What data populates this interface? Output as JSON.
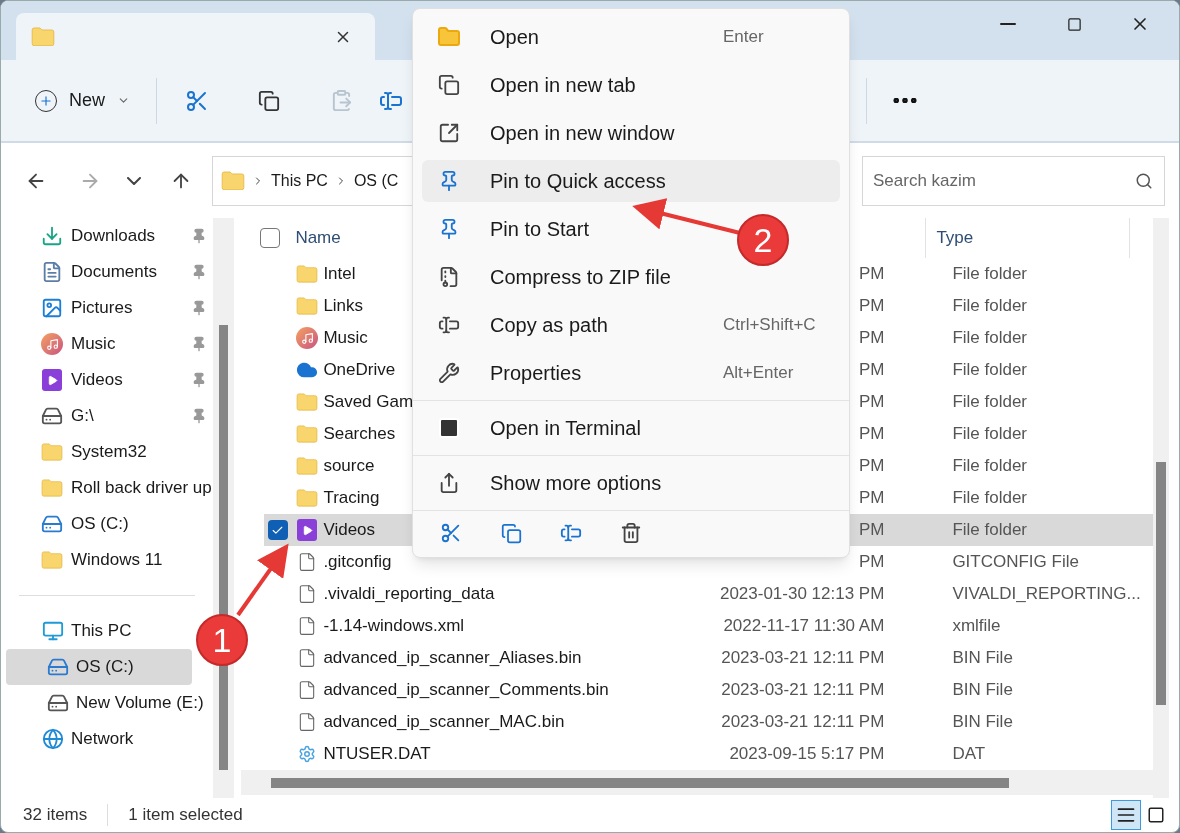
{
  "toolbar": {
    "new_label": "New",
    "paste_disabled": true
  },
  "navigation": {
    "forward_disabled": true
  },
  "address": {
    "crumbs": [
      "This PC",
      "OS (C"
    ]
  },
  "search": {
    "placeholder": "Search kazim"
  },
  "sidebar": {
    "quick_access": [
      {
        "label": "Downloads",
        "kind": "downloads",
        "pinned": true,
        "selected": false
      },
      {
        "label": "Documents",
        "kind": "documents",
        "pinned": true,
        "selected": false
      },
      {
        "label": "Pictures",
        "kind": "pictures",
        "pinned": true,
        "selected": false
      },
      {
        "label": "Music",
        "kind": "music",
        "pinned": true,
        "selected": false
      },
      {
        "label": "Videos",
        "kind": "videos",
        "pinned": true,
        "selected": false
      },
      {
        "label": "G:\\",
        "kind": "drive",
        "pinned": true,
        "selected": false
      },
      {
        "label": "System32",
        "kind": "folder",
        "pinned": false,
        "selected": false
      },
      {
        "label": "Roll back driver up",
        "kind": "folder",
        "pinned": false,
        "selected": false
      },
      {
        "label": "OS (C:)",
        "kind": "windows_drive",
        "pinned": false,
        "selected": false
      },
      {
        "label": "Windows 11",
        "kind": "folder",
        "pinned": false,
        "selected": false
      }
    ],
    "tree": [
      {
        "label": "This PC",
        "kind": "pc",
        "selected": false,
        "children": [
          {
            "label": "OS (C:)",
            "kind": "windows_drive",
            "selected": true
          },
          {
            "label": "New Volume (E:)",
            "kind": "drive",
            "selected": false
          }
        ]
      },
      {
        "label": "Network",
        "kind": "network",
        "selected": false
      }
    ]
  },
  "file_list": {
    "columns": [
      "Name",
      "Type"
    ],
    "all_checked": false,
    "rows": [
      {
        "name": "Intel",
        "kind": "folder",
        "date": "PM",
        "type": "File folder",
        "selected": false,
        "checked": false
      },
      {
        "name": "Links",
        "kind": "folder",
        "date": "PM",
        "type": "File folder",
        "selected": false,
        "checked": false
      },
      {
        "name": "Music",
        "kind": "music",
        "date": "PM",
        "type": "File folder",
        "selected": false,
        "checked": false
      },
      {
        "name": "OneDrive",
        "kind": "cloud",
        "date": "PM",
        "type": "File folder",
        "selected": false,
        "checked": false
      },
      {
        "name": "Saved Gam",
        "kind": "folder",
        "date": "PM",
        "type": "File folder",
        "selected": false,
        "checked": false
      },
      {
        "name": "Searches",
        "kind": "folder",
        "date": "PM",
        "type": "File folder",
        "selected": false,
        "checked": false
      },
      {
        "name": "source",
        "kind": "folder",
        "date": "PM",
        "type": "File folder",
        "selected": false,
        "checked": false
      },
      {
        "name": "Tracing",
        "kind": "folder",
        "date": "PM",
        "type": "File folder",
        "selected": false,
        "checked": false
      },
      {
        "name": "Videos",
        "kind": "videos",
        "date": "PM",
        "type": "File folder",
        "selected": true,
        "checked": true
      },
      {
        "name": ".gitconfig",
        "kind": "file",
        "date": "PM",
        "type": "GITCONFIG File",
        "selected": false,
        "checked": false
      },
      {
        "name": ".vivaldi_reporting_data",
        "kind": "file",
        "date": "2023-01-30 12:13 PM",
        "type": "VIVALDI_REPORTING...",
        "selected": false,
        "checked": false
      },
      {
        "name": "-1.14-windows.xml",
        "kind": "file",
        "date": "2022-11-17 11:30 AM",
        "type": "xmlfile",
        "selected": false,
        "checked": false
      },
      {
        "name": "advanced_ip_scanner_Aliases.bin",
        "kind": "file",
        "date": "2023-03-21 12:11 PM",
        "type": "BIN File",
        "selected": false,
        "checked": false
      },
      {
        "name": "advanced_ip_scanner_Comments.bin",
        "kind": "file",
        "date": "2023-03-21 12:11 PM",
        "type": "BIN File",
        "selected": false,
        "checked": false
      },
      {
        "name": "advanced_ip_scanner_MAC.bin",
        "kind": "file",
        "date": "2023-03-21 12:11 PM",
        "type": "BIN File",
        "selected": false,
        "checked": false
      },
      {
        "name": "NTUSER.DAT",
        "kind": "system",
        "date": "2023-09-15 5:17 PM",
        "type": "DAT",
        "selected": false,
        "checked": false
      }
    ]
  },
  "context_menu": {
    "groups": [
      [
        {
          "label": "Open",
          "shortcut": "Enter",
          "highlighted": false
        },
        {
          "label": "Open in new tab",
          "highlighted": false
        },
        {
          "label": "Open in new window",
          "highlighted": false
        },
        {
          "label": "Pin to Quick access",
          "highlighted": true
        },
        {
          "label": "Pin to Start",
          "highlighted": false
        },
        {
          "label": "Compress to ZIP file",
          "highlighted": false
        },
        {
          "label": "Copy as path",
          "shortcut": "Ctrl+Shift+C",
          "highlighted": false
        },
        {
          "label": "Properties",
          "shortcut": "Alt+Enter",
          "highlighted": false
        }
      ],
      [
        {
          "label": "Open in Terminal",
          "highlighted": false
        }
      ],
      [
        {
          "label": "Show more options",
          "highlighted": false
        }
      ]
    ]
  },
  "status_bar": {
    "count": "32 items",
    "selection": "1 item selected",
    "views": [
      {
        "selected": true
      },
      {
        "selected": false
      }
    ]
  },
  "annotations": [
    {
      "label": "1"
    },
    {
      "label": "2"
    }
  ]
}
